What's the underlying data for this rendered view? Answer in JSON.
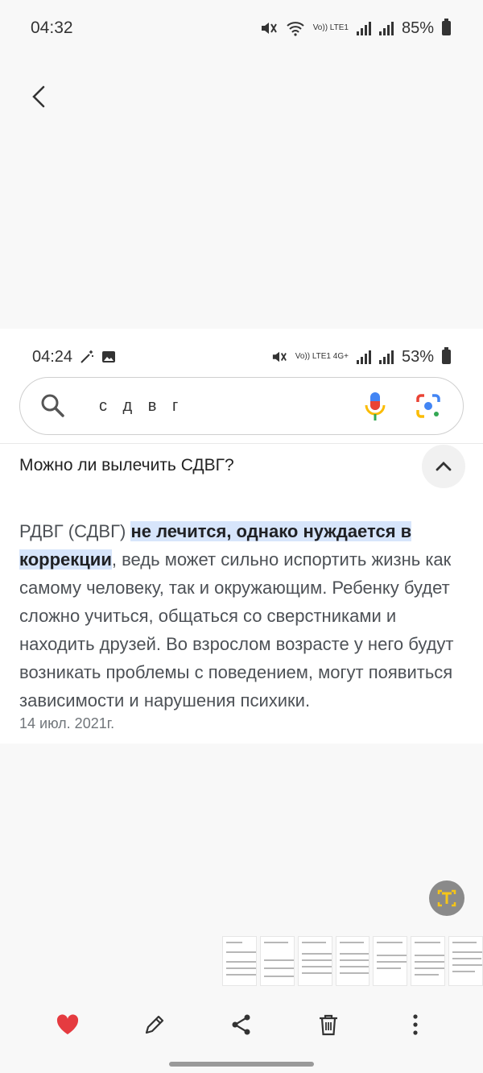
{
  "status_bar": {
    "time": "04:32",
    "battery": "85%",
    "network": "Vo)) LTE1"
  },
  "viewer": {
    "actions": [
      "remaster-icon",
      "eye-icon",
      "rotate-icon"
    ]
  },
  "screenshot": {
    "status": {
      "time": "04:24",
      "battery": "53%",
      "network": "Vo)) LTE1 4G+"
    },
    "search": {
      "query": "с д в г"
    },
    "question": "Можно ли вылечить СДВГ?",
    "answer": {
      "prefix": "РДВГ (СДВГ) ",
      "highlight": "не лечится, однако нуждается в коррекции",
      "rest": ", ведь может сильно испортить жизнь как самому человеку, так и окружающим. Ребенку будет сложно учиться, общаться со сверстниками и находить друзей. Во взрослом возрасте у него будут возникать проблемы с поведением, могут появиться зависимости и нарушения психики.",
      "date": "14 июл. 2021г."
    }
  },
  "toolbar": {
    "items": [
      "favorite",
      "edit",
      "share",
      "delete",
      "more"
    ]
  },
  "colors": {
    "accent_heart": "#e53b40",
    "highlight_bg": "#d7e5fb",
    "ocr_icon": "#f5c518"
  }
}
